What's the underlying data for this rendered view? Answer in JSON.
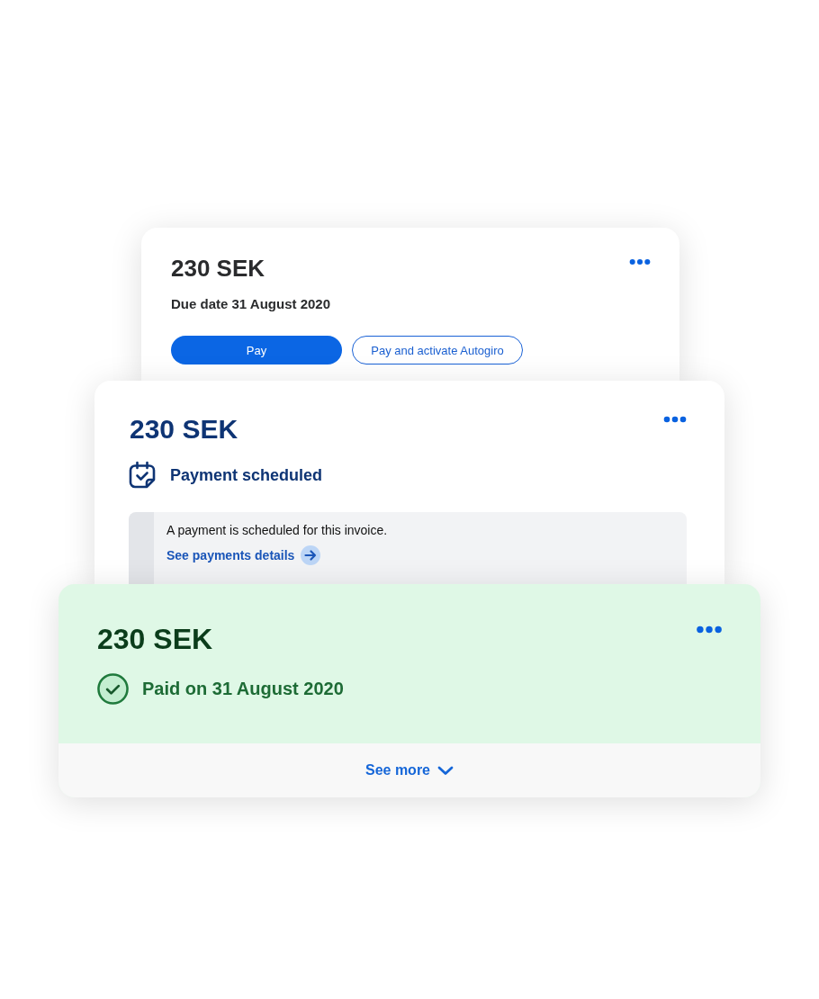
{
  "cards": [
    {
      "kind": "due",
      "amount": "230 SEK",
      "due_date": "Due date 31 August 2020",
      "buttons": [
        {
          "label": "Pay",
          "kind": "primary"
        },
        {
          "label": "Pay and activate Autogiro",
          "kind": "secondary"
        }
      ]
    },
    {
      "kind": "scheduled",
      "amount": "230 SEK",
      "status": "Payment scheduled",
      "notice": {
        "text": "A payment is scheduled for this invoice.",
        "link": "See payments details"
      }
    },
    {
      "kind": "paid",
      "amount": "230 SEK",
      "status": "Paid on 31 August 2020",
      "footer_link": "See more"
    }
  ]
}
